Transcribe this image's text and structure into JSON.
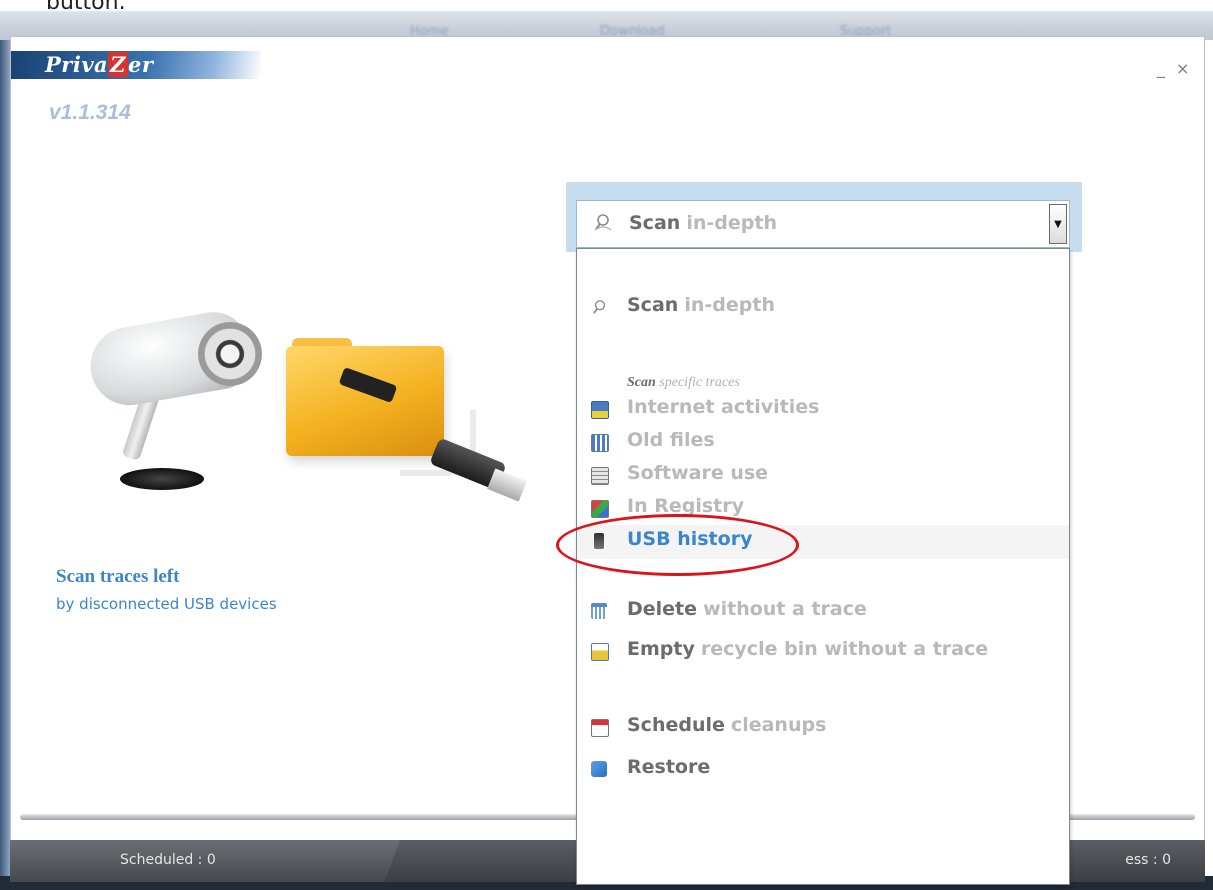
{
  "page": {
    "top_caption": "button."
  },
  "browser_nav": [
    "Home",
    "Download",
    "Support"
  ],
  "app": {
    "logo_left": "Priva",
    "logo_z": "Z",
    "logo_right": "er",
    "version": "v1.1.314",
    "minimize": "_",
    "close": "×"
  },
  "description": {
    "title": "Scan traces left",
    "subtitle": "by disconnected USB devices"
  },
  "dropdown": {
    "selected_bold": "Scan",
    "selected_light": "in-depth",
    "arrow": "▼",
    "items": [
      {
        "bold": "Scan",
        "light": "in-depth",
        "icon": "magnify-icon"
      },
      {
        "bold": "Internet activities",
        "light": "",
        "icon": "internet-icon"
      },
      {
        "bold": "Old files",
        "light": "",
        "icon": "old-files-icon"
      },
      {
        "bold": "Software use",
        "light": "",
        "icon": "software-icon"
      },
      {
        "bold": "In Registry",
        "light": "",
        "icon": "registry-icon"
      },
      {
        "bold": "USB history",
        "light": "",
        "icon": "usb-icon"
      },
      {
        "bold": "Delete",
        "light": "without a trace",
        "icon": "shredder-icon"
      },
      {
        "bold": "Empty",
        "light": "recycle bin without a trace",
        "icon": "recycle-bin-icon"
      },
      {
        "bold": "Schedule",
        "light": "cleanups",
        "icon": "calendar-icon"
      },
      {
        "bold": "Restore",
        "light": "",
        "icon": "restore-icon"
      }
    ],
    "section": {
      "bold": "Scan",
      "light": "specific traces"
    }
  },
  "status": {
    "scheduled": "Scheduled : 0",
    "progress": "ess : 0"
  },
  "colors": {
    "accent": "#3a86cc",
    "highlight_ring": "#d9141b",
    "combo_frame": "#c7def1"
  }
}
